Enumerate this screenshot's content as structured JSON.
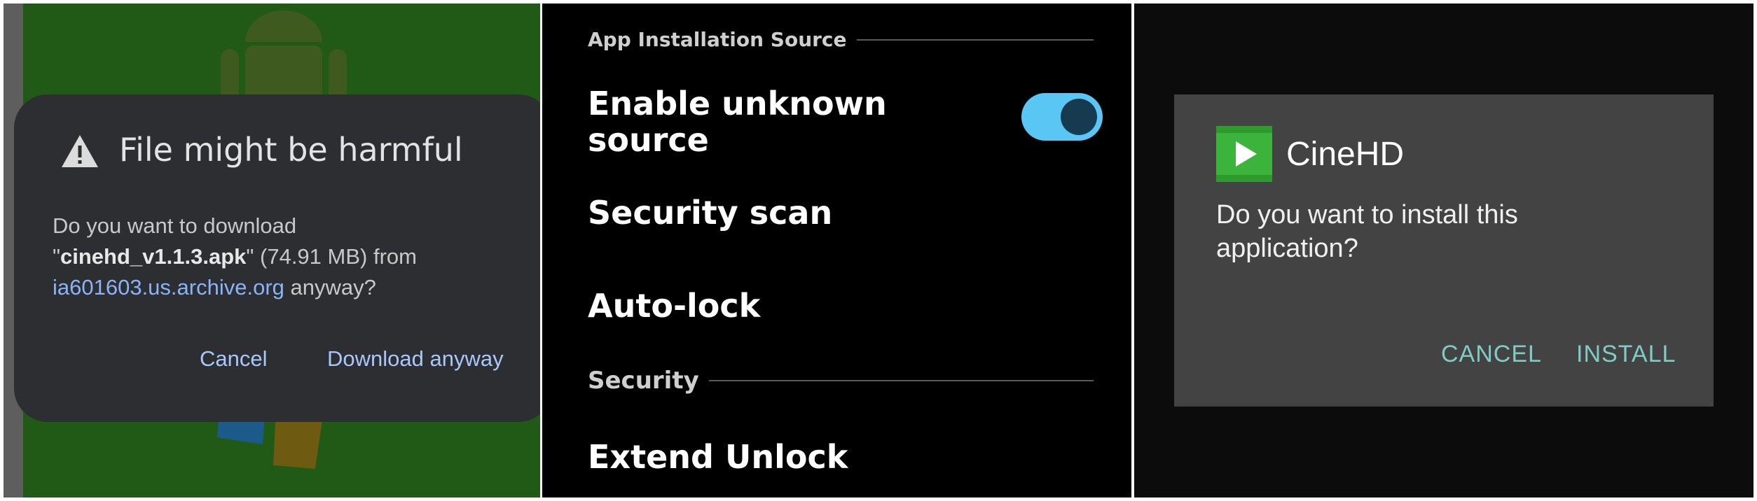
{
  "panel1": {
    "dialog_title": "File might be harmful",
    "line1": "Do you want to download",
    "quote_open": "\"",
    "filename": "cinehd_v1.1.3.apk",
    "quote_close": "\"",
    "size": " (74.91 MB) from",
    "host": "ia601603.us.archive.org",
    "tail": " anyway?",
    "cancel_label": "Cancel",
    "download_label": "Download anyway",
    "icons": {
      "warning": "warning-triangle-icon"
    },
    "colors": {
      "dialog_bg": "#2d2e31",
      "link": "#8ab4f8",
      "button": "#a8c7fa"
    }
  },
  "panel2": {
    "section_source": "App Installation Source",
    "enable_unknown": "Enable unknown source",
    "toggle_on": true,
    "security_scan": "Security scan",
    "auto_lock": "Auto-lock",
    "section_security": "Security",
    "extend_unlock": "Extend Unlock",
    "colors": {
      "toggle_track": "#5ac6f4",
      "toggle_knob": "#163a4f"
    }
  },
  "panel3": {
    "app_name": "CineHD",
    "question": "Do you want to install this application?",
    "cancel_label": "CANCEL",
    "install_label": "INSTALL",
    "icons": {
      "app": "cinehd-app-icon"
    },
    "colors": {
      "dialog_bg": "#434343",
      "button": "#80cbc4",
      "app_icon": "#3cb43c"
    }
  }
}
